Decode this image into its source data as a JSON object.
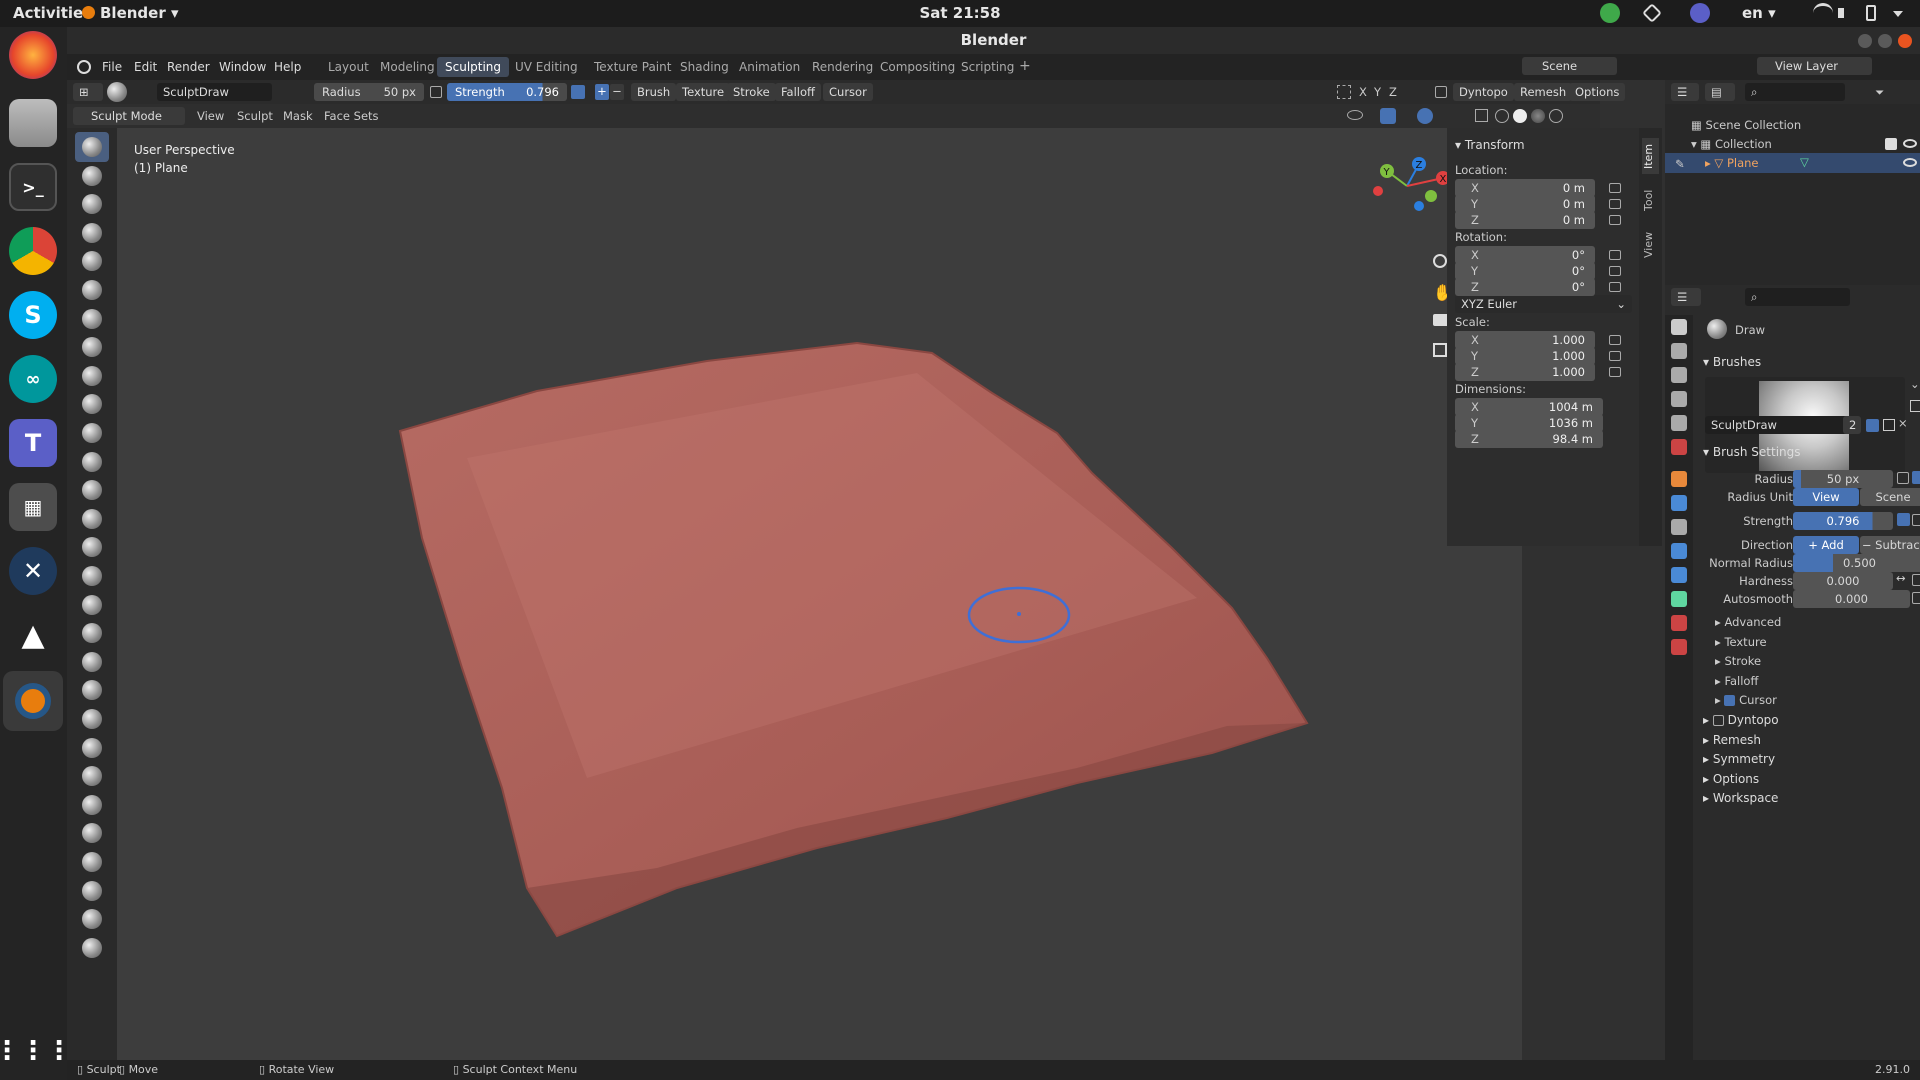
{
  "os": {
    "activities": "Activities",
    "app_menu": "Blender ▾",
    "clock": "Sat 21:58",
    "lang": "en ▾"
  },
  "window": {
    "title": "Blender"
  },
  "menu": [
    "File",
    "Edit",
    "Render",
    "Window",
    "Help"
  ],
  "workspaces": [
    "Layout",
    "Modeling",
    "Sculpting",
    "UV Editing",
    "Texture Paint",
    "Shading",
    "Animation",
    "Rendering",
    "Compositing",
    "Scripting"
  ],
  "active_workspace": "Sculpting",
  "scene": {
    "scene_name": "Scene",
    "view_layer": "View Layer"
  },
  "header": {
    "brush_name": "SculptDraw",
    "radius_label": "Radius",
    "radius_value": "50 px",
    "strength_label": "Strength",
    "strength_value": "0.796",
    "menus": [
      "Brush",
      "Texture",
      "Stroke",
      "Falloff",
      "Cursor"
    ],
    "axes": [
      "X",
      "Y",
      "Z"
    ],
    "right_menus": [
      "Dyntopo",
      "Remesh",
      "Options"
    ]
  },
  "header2": {
    "mode": "Sculpt Mode",
    "menus": [
      "View",
      "Sculpt",
      "Mask",
      "Face Sets"
    ]
  },
  "viewport": {
    "view_name": "User Perspective",
    "object": "(1) Plane"
  },
  "transform": {
    "title": "Transform",
    "location_label": "Location:",
    "location": [
      [
        "X",
        "0 m"
      ],
      [
        "Y",
        "0 m"
      ],
      [
        "Z",
        "0 m"
      ]
    ],
    "rotation_label": "Rotation:",
    "rotation": [
      [
        "X",
        "0°"
      ],
      [
        "Y",
        "0°"
      ],
      [
        "Z",
        "0°"
      ]
    ],
    "rotation_mode": "XYZ Euler",
    "scale_label": "Scale:",
    "scale": [
      [
        "X",
        "1.000"
      ],
      [
        "Y",
        "1.000"
      ],
      [
        "Z",
        "1.000"
      ]
    ],
    "dimensions_label": "Dimensions:",
    "dimensions": [
      [
        "X",
        "1004 m"
      ],
      [
        "Y",
        "1036 m"
      ],
      [
        "Z",
        "98.4 m"
      ]
    ]
  },
  "npanel_tabs": [
    "Item",
    "Tool",
    "View"
  ],
  "outliner": {
    "scene_collection": "Scene Collection",
    "collection": "Collection",
    "object": "Plane"
  },
  "properties": {
    "tool_name": "Draw",
    "brushes_label": "Brushes",
    "brush_name": "SculptDraw",
    "brush_users": "2",
    "brush_settings_label": "Brush Settings",
    "radius_label": "Radius",
    "radius_value": "50 px",
    "radius_unit_label": "Radius Unit",
    "unit_view": "View",
    "unit_scene": "Scene",
    "strength_label": "Strength",
    "strength_value": "0.796",
    "direction_label": "Direction",
    "dir_add": "Add",
    "dir_subtract": "Subtract",
    "normal_radius_label": "Normal Radius",
    "normal_radius_value": "0.500",
    "hardness_label": "Hardness",
    "hardness_value": "0.000",
    "autosmooth_label": "Autosmooth",
    "autosmooth_value": "0.000",
    "subpanels": [
      "Advanced",
      "Texture",
      "Stroke",
      "Falloff",
      "Cursor"
    ],
    "sections": [
      "Dyntopo",
      "Remesh",
      "Symmetry",
      "Options",
      "Workspace"
    ]
  },
  "status": {
    "items": [
      "Sculpt",
      "Move",
      "Rotate View",
      "Sculpt Context Menu"
    ],
    "version": "2.91.0"
  },
  "colors": {
    "accent": "#4772b3",
    "mesh": "#b56a62",
    "active_tab": "#404a5a"
  }
}
